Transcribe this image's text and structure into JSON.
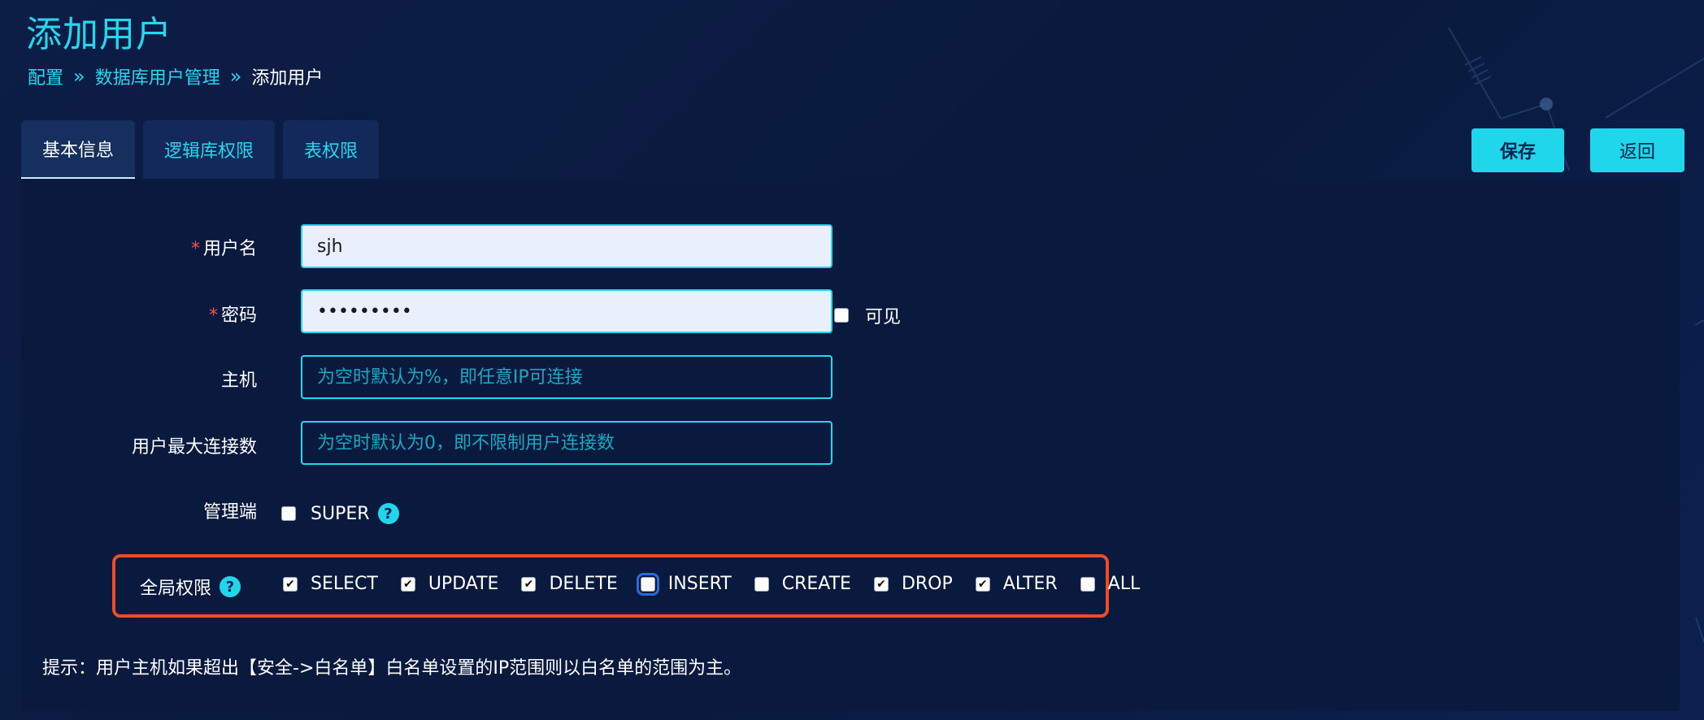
{
  "page_title": "添加用户",
  "breadcrumb": {
    "items": [
      "配置",
      "数据库用户管理"
    ],
    "separator": "»",
    "current": "添加用户"
  },
  "tabs": [
    {
      "label": "基本信息",
      "active": true
    },
    {
      "label": "逻辑库权限",
      "active": false
    },
    {
      "label": "表权限",
      "active": false
    }
  ],
  "actions": {
    "save_label": "保存",
    "back_label": "返回"
  },
  "form": {
    "required_mark": "*",
    "username": {
      "label": "用户名",
      "value": "sjh"
    },
    "password": {
      "label": "密码",
      "value": "•••••••••",
      "visible_label": "可见",
      "visible_checked": false
    },
    "host": {
      "label": "主机",
      "placeholder": "为空时默认为%，即任意IP可连接",
      "value": ""
    },
    "max_conn": {
      "label": "用户最大连接数",
      "placeholder": "为空时默认为0，即不限制用户连接数",
      "value": ""
    },
    "admin": {
      "label": "管理端",
      "option_label": "SUPER",
      "checked": false,
      "help_icon": "question-circle-icon",
      "help_glyph": "?"
    },
    "global_perms": {
      "label": "全局权限",
      "help_icon": "question-circle-icon",
      "help_glyph": "?",
      "items": [
        {
          "label": "SELECT",
          "checked": true,
          "focused": false
        },
        {
          "label": "UPDATE",
          "checked": true,
          "focused": false
        },
        {
          "label": "DELETE",
          "checked": true,
          "focused": false
        },
        {
          "label": "INSERT",
          "checked": false,
          "focused": true
        },
        {
          "label": "CREATE",
          "checked": false,
          "focused": false
        },
        {
          "label": "DROP",
          "checked": true,
          "focused": false
        },
        {
          "label": "ALTER",
          "checked": true,
          "focused": false
        },
        {
          "label": "ALL",
          "checked": false,
          "focused": false
        }
      ]
    }
  },
  "hint": "提示：用户主机如果超出【安全->白名单】白名单设置的IP范围则以白名单的范围为主。",
  "colors": {
    "accent": "#25d7ee",
    "button_bg": "#1fd6ea",
    "highlight_border": "#ef4b24",
    "required": "#ff4d4f",
    "background": "#0b1a40"
  }
}
